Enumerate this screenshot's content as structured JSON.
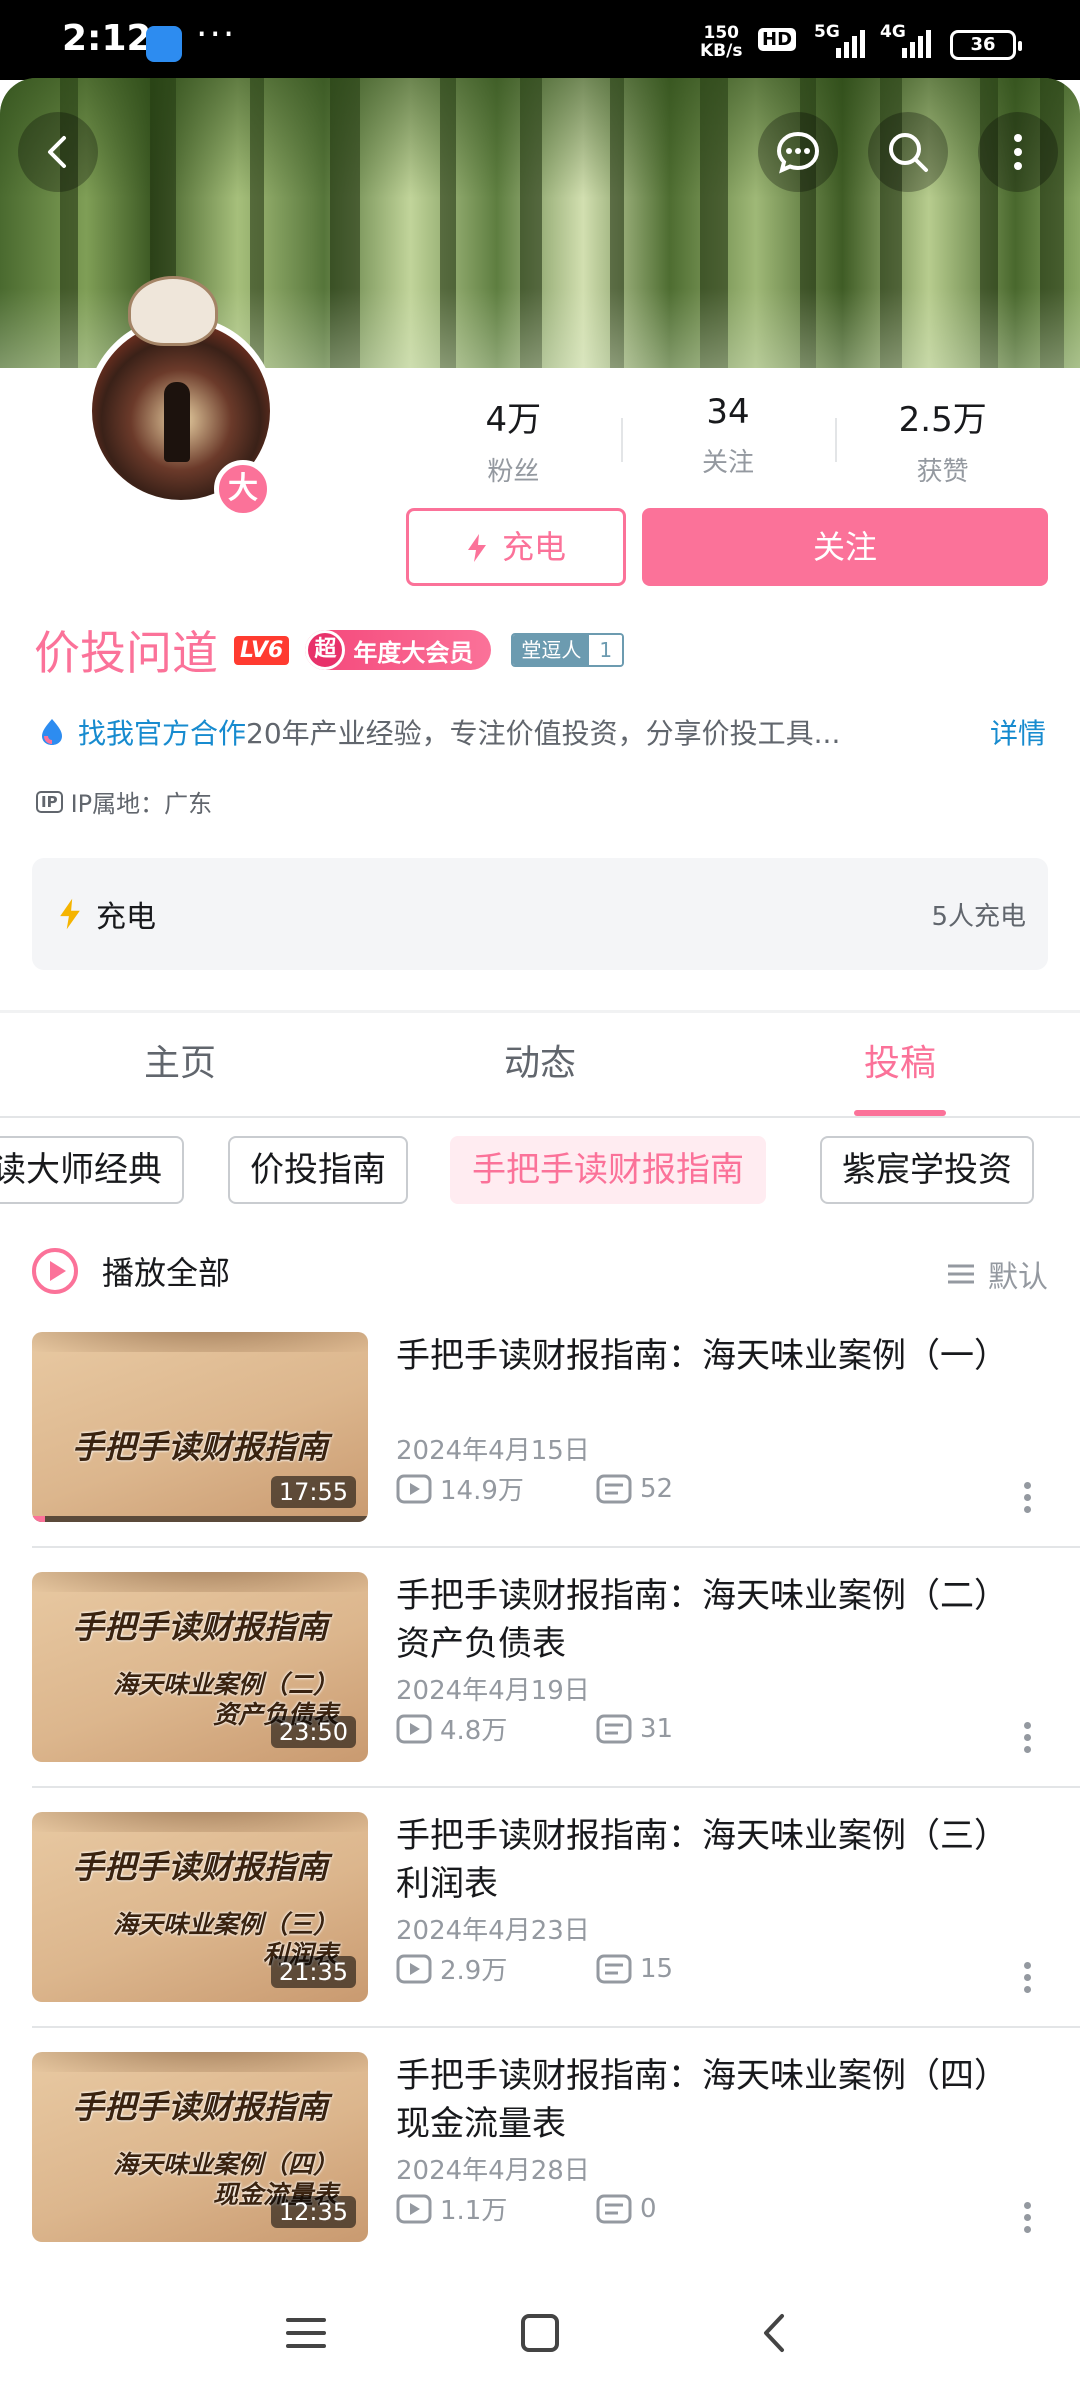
{
  "status_bar": {
    "time": "2:12",
    "dots": "···",
    "net_speed_value": "150",
    "net_speed_unit": "KB/s",
    "hd": "HD",
    "sig1": "5G",
    "sig2": "4G",
    "battery": "36"
  },
  "header": {
    "back_icon": "chevron-left-icon",
    "message_icon": "chat-bubble-icon",
    "search_icon": "search-icon",
    "more_icon": "more-vertical-icon"
  },
  "profile": {
    "avatar_badge": "大",
    "stats": [
      {
        "num": "4万",
        "label": "粉丝"
      },
      {
        "num": "34",
        "label": "关注"
      },
      {
        "num": "2.5万",
        "label": "获赞"
      }
    ],
    "charge_button": "充电",
    "follow_button": "关注",
    "username": "价投问道",
    "level": "LV6",
    "vip_char": "超",
    "vip_label": "年度大会员",
    "fan_badge_name": "堂逗人",
    "fan_badge_level": "1",
    "bio_link": "找我官方合作",
    "bio_text": "20年产业经验，专注价值投资，分享价投工具...",
    "bio_detail": "详情",
    "ip_tag": "IP",
    "ip_location": "IP属地：广东",
    "colors": {
      "accent": "#fb7299",
      "link": "#178bcf"
    }
  },
  "charge_card": {
    "label": "充电",
    "count": "5人充电"
  },
  "tabs": [
    {
      "label": "主页"
    },
    {
      "label": "动态"
    },
    {
      "label": "投稿",
      "active": true
    }
  ],
  "chips": [
    {
      "label": "读大师经典"
    },
    {
      "label": "价投指南"
    },
    {
      "label": "手把手读财报指南",
      "active": true
    },
    {
      "label": "紫宸学投资"
    }
  ],
  "list_header": {
    "play_all": "播放全部",
    "sort": "默认"
  },
  "videos": [
    {
      "thumb_title": "手把手读财报指南",
      "thumb_sub": "",
      "duration": "17:55",
      "progress": 0.04,
      "title": "手把手读财报指南：海天味业案例（一）",
      "date": "2024年4月15日",
      "views": "14.9万",
      "comments": "52"
    },
    {
      "thumb_title": "手把手读财报指南",
      "thumb_sub": "海天味业案例（二）\n资产负债表",
      "duration": "23:50",
      "title": "手把手读财报指南：海天味业案例（二）资产负债表",
      "date": "2024年4月19日",
      "views": "4.8万",
      "comments": "31"
    },
    {
      "thumb_title": "手把手读财报指南",
      "thumb_sub": "海天味业案例（三）\n利润表",
      "duration": "21:35",
      "title": "手把手读财报指南：海天味业案例（三）利润表",
      "date": "2024年4月23日",
      "views": "2.9万",
      "comments": "15"
    },
    {
      "thumb_title": "手把手读财报指南",
      "thumb_sub": "海天味业案例（四）\n现金流量表",
      "duration": "12:35",
      "title": "手把手读财报指南：海天味业案例（四）现金流量表",
      "date": "2024年4月28日",
      "views": "1.1万",
      "comments": "0"
    }
  ],
  "nav_bar": {
    "menu_icon": "menu-icon",
    "home_icon": "home-square-icon",
    "back_icon": "back-triangle-icon"
  }
}
